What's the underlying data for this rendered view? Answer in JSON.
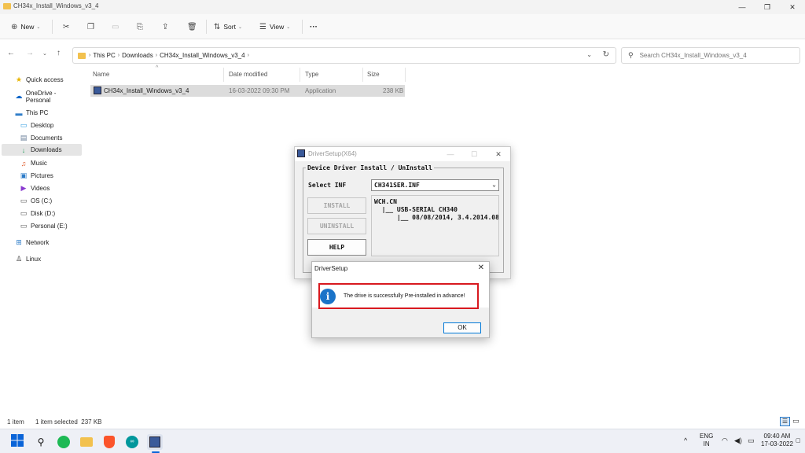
{
  "window": {
    "title": "CH34x_Install_Windows_v3_4"
  },
  "toolbar": {
    "new_label": "New",
    "sort_label": "Sort",
    "view_label": "View",
    "more_label": "···"
  },
  "address": {
    "crumbs": [
      "This PC",
      "Downloads",
      "CH34x_Install_Windows_v3_4"
    ],
    "search_placeholder": "Search CH34x_Install_Windows_v3_4"
  },
  "sidebar": {
    "items": [
      {
        "label": "Quick access",
        "icon": "star-icon"
      },
      {
        "label": "OneDrive - Personal",
        "icon": "cloud-icon"
      },
      {
        "label": "This PC",
        "icon": "computer-icon"
      },
      {
        "label": "Desktop",
        "icon": "desktop-icon"
      },
      {
        "label": "Documents",
        "icon": "documents-icon"
      },
      {
        "label": "Downloads",
        "icon": "download-icon",
        "selected": true
      },
      {
        "label": "Music",
        "icon": "music-icon"
      },
      {
        "label": "Pictures",
        "icon": "pictures-icon"
      },
      {
        "label": "Videos",
        "icon": "videos-icon"
      },
      {
        "label": "OS (C:)",
        "icon": "drive-icon"
      },
      {
        "label": "Disk (D:)",
        "icon": "drive-icon"
      },
      {
        "label": "Personal (E:)",
        "icon": "drive-icon"
      },
      {
        "label": "Network",
        "icon": "network-icon"
      },
      {
        "label": "Linux",
        "icon": "linux-icon"
      }
    ]
  },
  "filelist": {
    "columns": [
      "Name",
      "Date modified",
      "Type",
      "Size"
    ],
    "rows": [
      {
        "name": "CH34x_Install_Windows_v3_4",
        "date": "16-03-2022 09:30 PM",
        "type": "Application",
        "size": "238 KB"
      }
    ]
  },
  "status": {
    "items": "1 item",
    "selected": "1 item selected  237 KB"
  },
  "driversetup": {
    "title": "DriverSetup(X64)",
    "group_title": "Device Driver Install / UnInstall",
    "select_label": "Select INF",
    "select_value": "CH341SER.INF",
    "install_label": "INSTALL",
    "uninstall_label": "UNINSTALL",
    "help_label": "HELP",
    "info_text": "WCH.CN\n  |__ USB-SERIAL CH340\n      |__ 08/08/2014, 3.4.2014.08"
  },
  "messagebox": {
    "title": "DriverSetup",
    "message": "The drive is successfully Pre-installed in advance!",
    "ok_label": "OK"
  },
  "taskbar": {
    "lang_top": "ENG",
    "lang_bottom": "IN",
    "time": "09:40 AM",
    "date": "17-03-2022"
  },
  "colors": {
    "accent": "#0078d7",
    "highlight_border": "#d8191f",
    "info_icon": "#1a73c8",
    "selected_row": "#dcdcdc"
  }
}
